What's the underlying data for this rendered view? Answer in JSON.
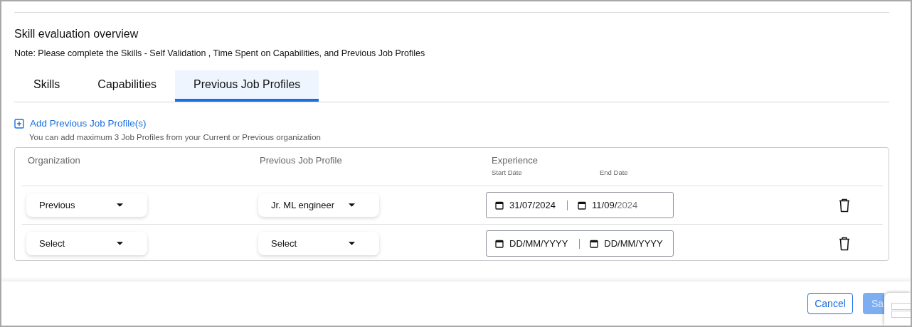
{
  "heading": "Skill evaluation overview",
  "note": "Note: Please complete the Skills - Self Validation , Time Spent on Capabilities, and Previous Job Profiles",
  "tabs": [
    {
      "label": "Skills",
      "selected": false
    },
    {
      "label": "Capabilities",
      "selected": false
    },
    {
      "label": "Previous Job Profiles",
      "selected": true
    }
  ],
  "add_link": "Add Previous Job Profile(s)",
  "add_hint": "You can add maximum 3 Job Profiles from your Current or Previous organization",
  "table": {
    "columns": [
      "Organization",
      "Previous Job Profile",
      "Experience"
    ],
    "start_label": "Start Date",
    "end_label": "End Date",
    "rows": [
      {
        "organization": "Previous",
        "job_profile": "Jr. ML engineer",
        "start_date": "31/07/2024",
        "end_date": "11/09/",
        "end_date_hint": "2024"
      },
      {
        "organization": "Select",
        "job_profile": "Select",
        "start_placeholder": "DD/MM/YYYY",
        "end_placeholder": "DD/MM/YYYY"
      }
    ]
  },
  "buttons": {
    "cancel": "Cancel",
    "save": "Sa",
    "save_disabled": true
  }
}
